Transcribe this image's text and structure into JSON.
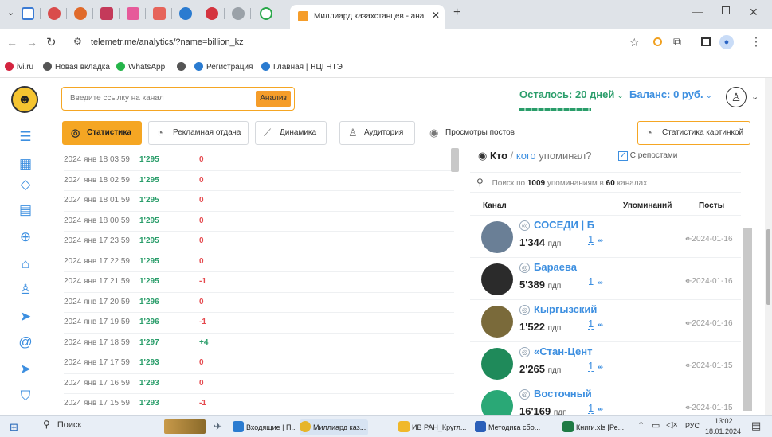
{
  "browser": {
    "active_tab_title": "Миллиард казахстанцев - анал",
    "url": "telemetr.me/analytics/?name=billion_kz",
    "bookmarks": [
      "ivi.ru",
      "Новая вкладка",
      "WhatsApp",
      "Регистрация",
      "Главная | НЦГНТЭ"
    ]
  },
  "header": {
    "search_placeholder": "Введите ссылку на канал",
    "analyze_label": "Анализ",
    "remaining": "Осталось: 20 дней",
    "balance": "Баланс: 0 руб."
  },
  "tabs": [
    "Статистика",
    "Рекламная отдача",
    "Динамика",
    "Аудитория",
    "Просмотры постов"
  ],
  "image_stats_label": "Статистика картинкой",
  "stats_rows": [
    {
      "date": "2024 янв 18 03:59",
      "value": "1'295",
      "change": "0"
    },
    {
      "date": "2024 янв 18 02:59",
      "value": "1'295",
      "change": "0"
    },
    {
      "date": "2024 янв 18 01:59",
      "value": "1'295",
      "change": "0"
    },
    {
      "date": "2024 янв 18 00:59",
      "value": "1'295",
      "change": "0"
    },
    {
      "date": "2024 янв 17 23:59",
      "value": "1'295",
      "change": "0"
    },
    {
      "date": "2024 янв 17 22:59",
      "value": "1'295",
      "change": "0"
    },
    {
      "date": "2024 янв 17 21:59",
      "value": "1'295",
      "change": "-1"
    },
    {
      "date": "2024 янв 17 20:59",
      "value": "1'296",
      "change": "0"
    },
    {
      "date": "2024 янв 17 19:59",
      "value": "1'296",
      "change": "-1"
    },
    {
      "date": "2024 янв 17 18:59",
      "value": "1'297",
      "change": "+4"
    },
    {
      "date": "2024 янв 17 17:59",
      "value": "1'293",
      "change": "0"
    },
    {
      "date": "2024 янв 17 16:59",
      "value": "1'293",
      "change": "0"
    },
    {
      "date": "2024 янв 17 15:59",
      "value": "1'293",
      "change": "-1"
    }
  ],
  "mentions": {
    "who": "Кто",
    "whom": "кого",
    "title_suffix": "упоминал?",
    "reposts_label": "С репостами",
    "search_prefix": "Поиск по",
    "search_count": "1009",
    "search_mid": "упоминаниям в",
    "search_channels": "60",
    "search_suffix": "каналах",
    "col_channel": "Канал",
    "col_mentions": "Упоминаний",
    "col_posts": "Посты",
    "channels": [
      {
        "name": "СОСЕДИ | Б",
        "subs": "1'344",
        "unit": "пдп",
        "mentions": "1",
        "date": "2024-01-16",
        "color": "#6a7f96"
      },
      {
        "name": "Бараева",
        "subs": "5'389",
        "unit": "пдп",
        "mentions": "1",
        "date": "2024-01-16",
        "color": "#2b2b2b"
      },
      {
        "name": "Кыргызский",
        "subs": "1'522",
        "unit": "пдп",
        "mentions": "1",
        "date": "2024-01-16",
        "color": "#7a6a3a"
      },
      {
        "name": "«Стан-Цент",
        "subs": "2'265",
        "unit": "пдп",
        "mentions": "1",
        "date": "2024-01-15",
        "color": "#1f8a5a"
      },
      {
        "name": "Восточный",
        "subs": "16'169",
        "unit": "пдп",
        "mentions": "1",
        "date": "2024-01-15",
        "color": "#2aa876"
      }
    ]
  },
  "taskbar": {
    "search": "Поиск",
    "apps": [
      "Входящие | П...",
      "Миллиард каз...",
      "ИВ РАН_Кругл...",
      "Методика сбо...",
      "Книги.xls [Ре..."
    ],
    "lang": "РУС",
    "time": "13:02",
    "date": "18.01.2024"
  },
  "colors": {
    "accent": "#f59d2a",
    "link": "#3d8fe0",
    "positive": "#2a9d6a",
    "negative": "#e5484d"
  }
}
